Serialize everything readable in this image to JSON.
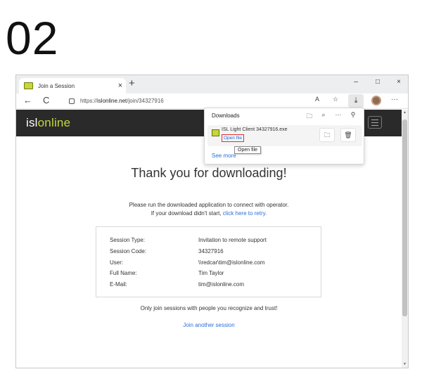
{
  "step_number": "02",
  "browser": {
    "tab": {
      "title": "Join a Session",
      "close_glyph": "×",
      "favicon": "monitor-icon"
    },
    "new_tab_glyph": "+",
    "window_controls": {
      "minimize": "–",
      "maximize": "□",
      "close": "×"
    },
    "nav": {
      "back": "←",
      "reload": "C"
    },
    "url": {
      "prefix": "https://",
      "domain": "islonline.net",
      "path": "/join/34327916"
    },
    "toolbar_icons": {
      "read_aloud": "A",
      "favorites": "☆",
      "download": "⤓",
      "more": "···"
    }
  },
  "downloads": {
    "title": "Downloads",
    "header_icons": {
      "folder": "🗀",
      "search": "⌕",
      "more": "···",
      "pin": "⚲"
    },
    "item": {
      "file_name": "ISL Light Client 34327916.exe",
      "open_link": "Open file"
    },
    "actions": {
      "show_in_folder": "🗀",
      "delete": "🗑"
    },
    "see_more": "See more",
    "tooltip": "Open file"
  },
  "site": {
    "logo_part1": "isl",
    "logo_part2": "online",
    "heading": "Thank you for downloading!",
    "instruction_line1": "Please run the downloaded application to connect with operator.",
    "instruction_line2_prefix": "If your download didn't start, ",
    "instruction_line2_link": "click here to retry.",
    "session": [
      {
        "label": "Session Type:",
        "value": "Invitation to remote support"
      },
      {
        "label": "Session Code:",
        "value": "34327916"
      },
      {
        "label": "User:",
        "value": "\\\\redcar\\tim@islonline.com"
      },
      {
        "label": "Full Name:",
        "value": "Tim Taylor"
      },
      {
        "label": "E-Mail:",
        "value": "tim@islonline.com"
      }
    ],
    "warning": "Only join sessions with people you recognize and trust!",
    "join_another": "Join another session"
  },
  "colors": {
    "accent_green": "#c7d63a",
    "link_blue": "#2a6fd6",
    "header_dark": "#2a2a2a",
    "highlight_red": "#e03030"
  }
}
